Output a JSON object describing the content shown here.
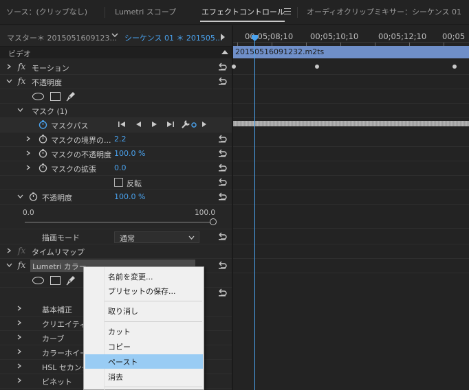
{
  "tabs": [
    {
      "label": "ソース：(クリップなし)"
    },
    {
      "label": "Lumetri スコープ"
    },
    {
      "label": "エフェクトコントロール"
    },
    {
      "label": "オーディオクリップミキサー：シーケンス 01"
    }
  ],
  "sequence_header": {
    "master": "マスター＊ 2015051609123...",
    "sequence": "シーケンス 01 ＊ 201505..."
  },
  "section_label": "ビデオ",
  "effects": {
    "motion": "モーション",
    "opacity": "不透明度",
    "mask": "マスク (1)",
    "mask_path": "マスクパス",
    "mask_feather": {
      "label": "マスクの境界の...",
      "value": "2.2"
    },
    "mask_opacity": {
      "label": "マスクの不透明度",
      "value": "100.0 %"
    },
    "mask_expansion": {
      "label": "マスクの拡張",
      "value": "0.0"
    },
    "invert": "反転",
    "opacity_param": {
      "label": "不透明度",
      "value": "100.0 %"
    },
    "slider": {
      "min": "0.0",
      "max": "100.0",
      "level": 1.0
    },
    "blend_mode": {
      "label": "描画モード",
      "value": "通常"
    },
    "time_remap": "タイムリマップ",
    "lumetri": "Lumetri カラー",
    "lumetri_items": [
      "基本補正",
      "クリエイティ",
      "カーブ",
      "カラーホイー",
      "HSL セカンダ",
      "ビネット"
    ]
  },
  "timeline": {
    "timecodes": [
      "00;05;08;10",
      "00;05;10;10",
      "00;05;12;10",
      "00;05"
    ],
    "clip_name": "20150516091232.m2ts"
  },
  "context_menu": {
    "items": [
      "名前を変更...",
      "プリセットの保存...",
      "取り消し",
      "カット",
      "コピー",
      "ペースト",
      "消去"
    ],
    "highlighted": "ペースト"
  },
  "colors": {
    "accent": "#4aa3ef",
    "clip": "#6f8fc9",
    "menu_highlight": "#99ccf4"
  }
}
